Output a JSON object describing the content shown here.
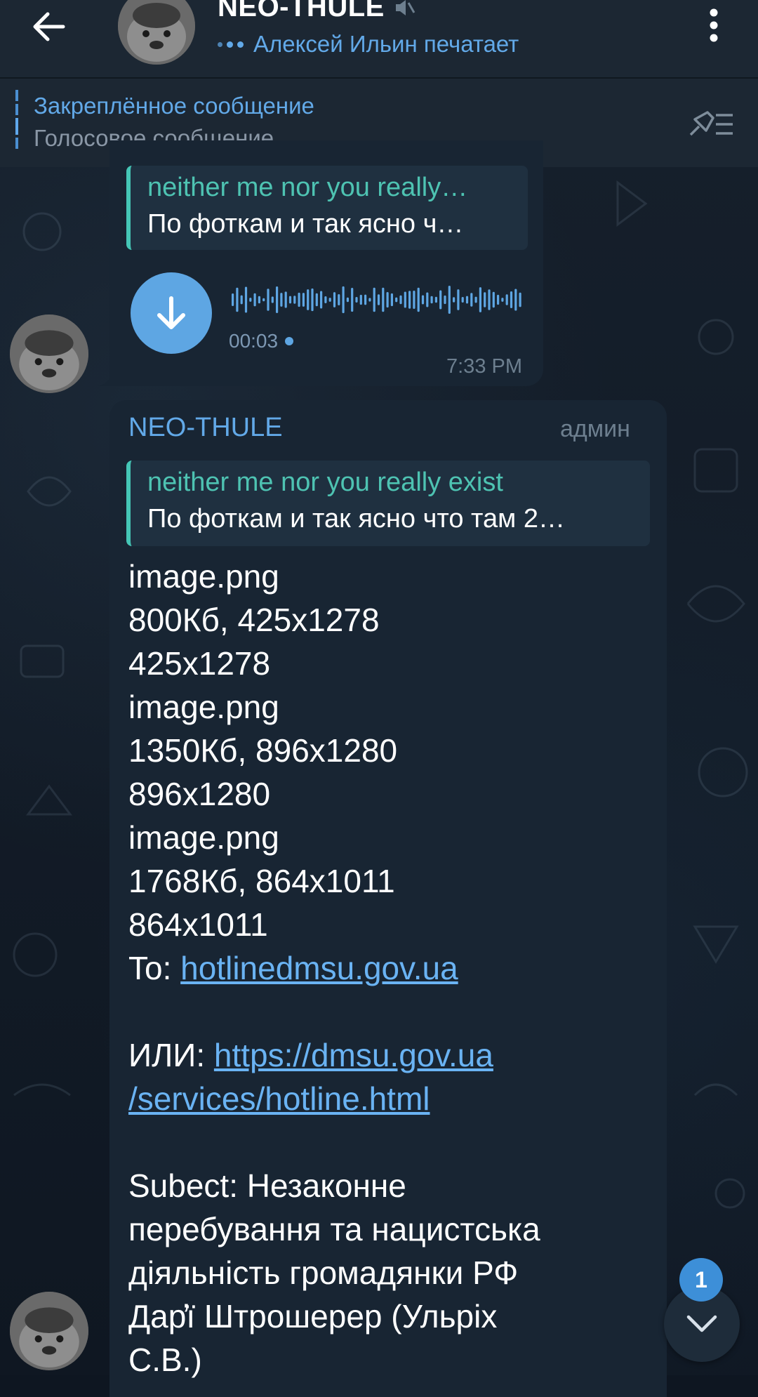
{
  "header": {
    "title": "NEO-THULE",
    "status": "Алексей Ильин печатает"
  },
  "pinned": {
    "title": "Закреплённое сообщение",
    "text": "Голосовое сообщение"
  },
  "voice_message": {
    "reply_name": "neither me nor you really…",
    "reply_text": "По фоткам и так ясно ч…",
    "duration": "00:03",
    "time": "7:33 PM"
  },
  "message": {
    "sender": "NEO-THULE",
    "badge": "админ",
    "reply_name": "neither me nor you really exist",
    "reply_text": "По фоткам и так ясно что там 2…",
    "lines": [
      "image.png",
      "800Кб, 425x1278",
      "425x1278",
      "image.png",
      "1350Кб, 896x1280",
      "896x1280",
      "image.png",
      "1768Кб, 864x1011",
      "864x1011"
    ],
    "to_label": "To: ",
    "to_link": "hotlinedmsu.gov.ua",
    "or_label": "ИЛИ: ",
    "or_link_1": "https://dmsu.gov.ua",
    "or_link_2": "/services/hotline.html",
    "subject_lines": [
      "Subect: Незаконне",
      "перебування та нацистська",
      "діяльність громадянки РФ",
      "Дар̓ї Штрошерер (Ульріх",
      "С.В.)"
    ]
  },
  "scroll": {
    "unread_count": "1"
  },
  "colors": {
    "accent": "#62a9e8",
    "reply_accent": "#45c6b6",
    "bubble": "#182533",
    "header": "#1c2733"
  }
}
